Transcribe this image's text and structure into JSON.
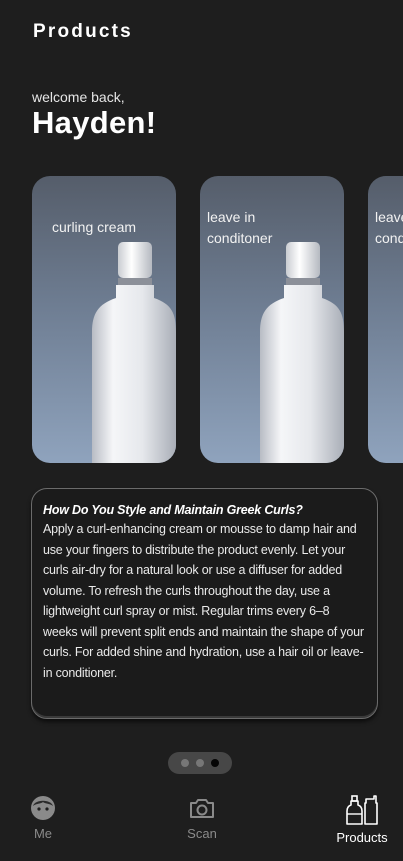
{
  "header": {
    "title": "Products"
  },
  "greeting": {
    "welcome": "welcome back,",
    "name": "Hayden!"
  },
  "products": [
    {
      "label": "curling cream"
    },
    {
      "label": "leave in conditoner"
    },
    {
      "label": "leave in conditoner"
    }
  ],
  "tip": {
    "title": "How Do You Style and Maintain Greek Curls?",
    "body": "Apply a curl-enhancing cream or mousse to damp hair and use your fingers to distribute the product evenly. Let your curls air-dry for a natural look or use a diffuser for added volume. To refresh the curls throughout the day, use a lightweight curl spray or mist. Regular trims every 6–8 weeks will prevent split ends and maintain the shape of your curls. For added shine and hydration, use a hair oil or leave-in conditioner."
  },
  "pager": {
    "count": 3,
    "active_index": 2
  },
  "nav": {
    "items": [
      {
        "label": "Me",
        "icon": "face-icon"
      },
      {
        "label": "Scan",
        "icon": "camera-icon"
      },
      {
        "label": "Products",
        "icon": "bottles-icon"
      }
    ],
    "active": "Products"
  }
}
